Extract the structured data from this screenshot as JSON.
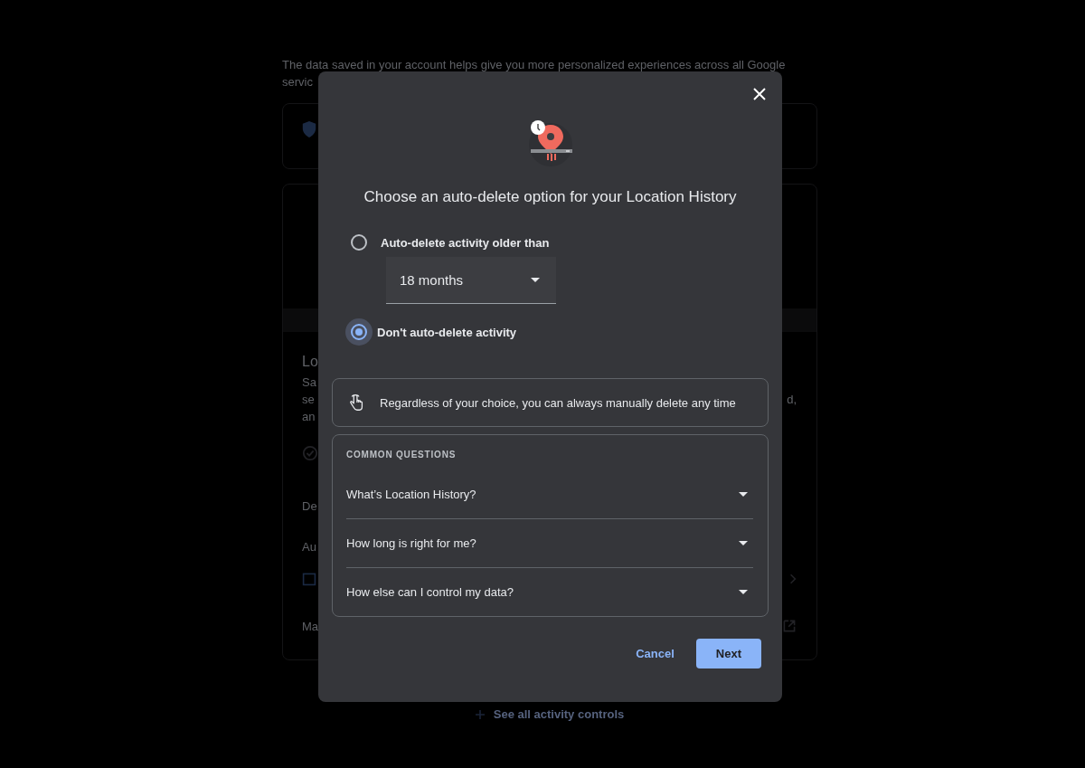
{
  "background": {
    "intro_lines": [
      "The data saved in your account helps give you more personalized experiences across all Google",
      "servic"
    ],
    "activity_card": {
      "heading": "Lo",
      "description_lines": [
        "Sa",
        "se",
        "an"
      ],
      "description_end": "d,",
      "rows": [
        "De",
        "Au",
        "Ma"
      ]
    },
    "footer_link": "See all activity controls"
  },
  "dialog": {
    "title": "Choose an auto-delete option for your Location History",
    "options": [
      {
        "label": "Auto-delete activity older than",
        "selected": false,
        "select": {
          "value": "18 months"
        }
      },
      {
        "label": "Don't auto-delete activity",
        "selected": true
      }
    ],
    "info": "Regardless of your choice, you can always manually delete any time",
    "faq": {
      "heading": "COMMON QUESTIONS",
      "items": [
        {
          "question": "What’s Location History?",
          "expanded": false
        },
        {
          "question": "How long is right for me?",
          "expanded": false
        },
        {
          "question": "How else can I control my data?",
          "expanded": false
        }
      ]
    },
    "buttons": [
      {
        "label": "Cancel",
        "kind": "text"
      },
      {
        "label": "Next",
        "kind": "filled"
      }
    ]
  }
}
